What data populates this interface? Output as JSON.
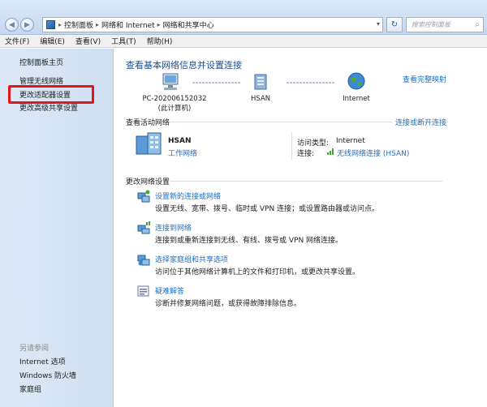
{
  "address_bar": {
    "crumbs": [
      "控制面板",
      "网络和 Internet",
      "网络和共享中心"
    ],
    "search_placeholder": "搜索控制面板"
  },
  "menu": [
    "文件(F)",
    "编辑(E)",
    "查看(V)",
    "工具(T)",
    "帮助(H)"
  ],
  "sidebar": {
    "items": [
      "控制面板主页",
      "管理无线网络",
      "更改适配器设置",
      "更改高级共享设置"
    ],
    "see_also_label": "另请参阅",
    "see_also": [
      "Internet 选项",
      "Windows 防火墙",
      "家庭组"
    ],
    "highlighted_item": "更改适配器设置"
  },
  "main": {
    "title": "查看基本网络信息并设置连接",
    "full_map_link": "查看完整映射",
    "map": {
      "computer_name": "PC-202006152032",
      "computer_sub": "(此计算机)",
      "network_name": "HSAN",
      "internet_label": "Internet"
    },
    "active_networks": {
      "heading": "查看活动网络",
      "connect_disconnect_link": "连接或断开连接",
      "network_name": "HSAN",
      "network_type": "工作网络",
      "access_type_label": "访问类型:",
      "access_type_value": "Internet",
      "connection_label": "连接:",
      "connection_value": "无线网络连接 (HSAN)"
    },
    "change_settings": {
      "heading": "更改网络设置",
      "tasks": [
        {
          "title": "设置新的连接或网络",
          "desc": "设置无线、宽带、拨号、临时或 VPN 连接；或设置路由器或访问点。",
          "icon": "network-setup-icon"
        },
        {
          "title": "连接到网络",
          "desc": "连接到或重新连接到无线、有线、拨号或 VPN 网络连接。",
          "icon": "connect-network-icon"
        },
        {
          "title": "选择家庭组和共享选项",
          "desc": "访问位于其他网络计算机上的文件和打印机，或更改共享设置。",
          "icon": "homegroup-icon"
        },
        {
          "title": "疑难解答",
          "desc": "诊断并修复网络问题，或获得故障排除信息。",
          "icon": "troubleshoot-icon"
        }
      ]
    }
  },
  "colors": {
    "link": "#1f6fc1",
    "title": "#1f4e8c",
    "highlight_box": "#e3151b",
    "sidebar_bg": "#d6e4f4"
  }
}
